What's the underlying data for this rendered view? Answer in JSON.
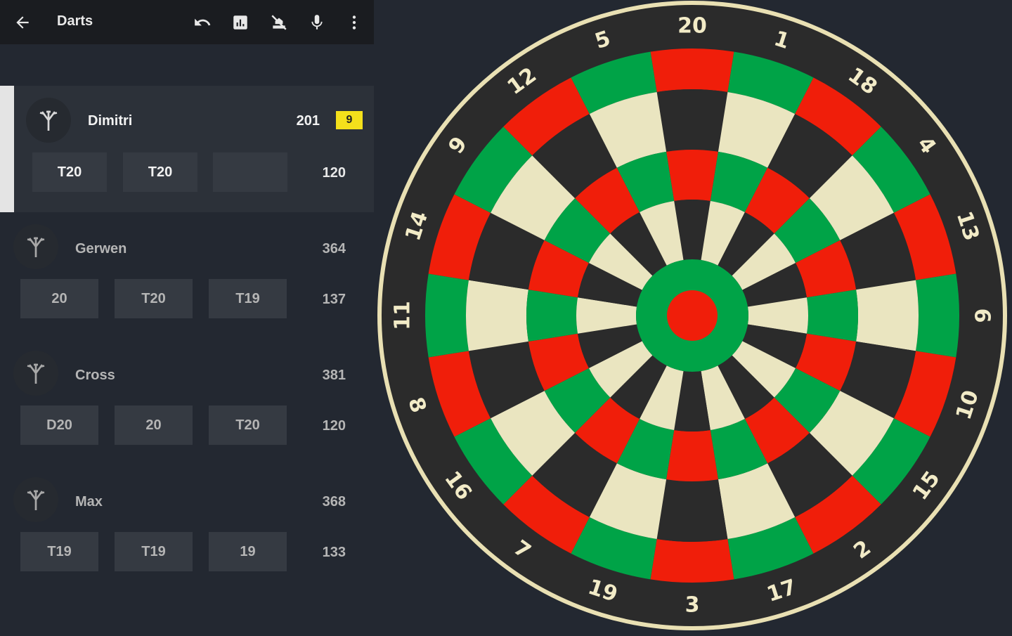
{
  "app": {
    "title": "Darts"
  },
  "toolbar": {
    "icons": [
      "back-arrow-icon",
      "undo-icon",
      "stats-icon",
      "no-bust-icon",
      "microphone-icon",
      "more-vert-icon"
    ]
  },
  "players": [
    {
      "name": "Dimitri",
      "score": "201",
      "badge": "9",
      "darts": [
        "T20",
        "T20",
        ""
      ],
      "total": "120",
      "active": true
    },
    {
      "name": "Gerwen",
      "score": "364",
      "darts": [
        "20",
        "T20",
        "T19"
      ],
      "total": "137",
      "active": false
    },
    {
      "name": "Cross",
      "score": "381",
      "darts": [
        "D20",
        "20",
        "T20"
      ],
      "total": "120",
      "active": false
    },
    {
      "name": "Max",
      "score": "368",
      "darts": [
        "T19",
        "T19",
        "19"
      ],
      "total": "133",
      "active": false
    }
  ],
  "board": {
    "numbers": [
      "20",
      "1",
      "18",
      "4",
      "13",
      "6",
      "10",
      "15",
      "2",
      "17",
      "3",
      "19",
      "7",
      "16",
      "8",
      "11",
      "14",
      "9",
      "12",
      "5"
    ],
    "colors": {
      "red": "#f01e0a",
      "green": "#00a347",
      "cream": "#eae5c0",
      "black": "#2b2b2b",
      "frame": "#e9e0b3",
      "text": "#f2ebc7"
    }
  }
}
